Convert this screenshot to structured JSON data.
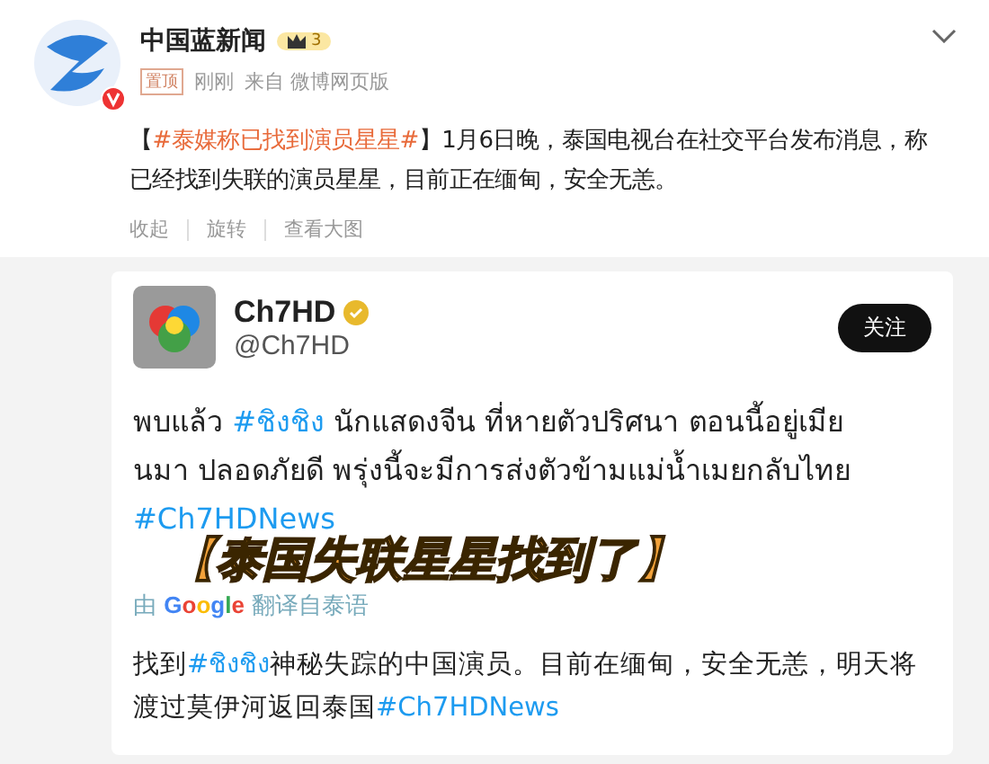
{
  "post": {
    "author": "中国蓝新闻",
    "level_badge": "3",
    "tag": "置顶",
    "time": "刚刚",
    "source": "来自 微博网页版",
    "text_parts": [
      {
        "text": "【",
        "kind": "plain"
      },
      {
        "text": "#泰媒称已找到演员星星#",
        "kind": "tag"
      },
      {
        "text": "】1月6日晚，泰国电视台在社交平台发布消息，称已经找到失联的演员星星，目前正在缅甸，安全无恙。",
        "kind": "plain"
      }
    ],
    "actions": [
      "收起",
      "旋转",
      "查看大图"
    ]
  },
  "embedded": {
    "name": "Ch7HD",
    "handle": "@Ch7HD",
    "follow_button": "关注",
    "thai_parts": [
      {
        "text": "พบแล้ว ",
        "kind": "plain"
      },
      {
        "text": "#ชิงชิง",
        "kind": "tag"
      },
      {
        "text": " นักแสดงจีน ที่หายตัวปริศนา ตอนนี้อยู่เมียนมา ปลอดภัยดี พรุ่งนี้จะมีการส่งตัวข้ามแม่น้ำเมยกลับไทย ",
        "kind": "plain"
      },
      {
        "text": "#Ch7HDNews",
        "kind": "tag"
      }
    ],
    "caption": "【泰国失联星星找到了】",
    "translated_by": "由",
    "google": "Google",
    "translated_from": "翻译自泰语",
    "zh_parts": [
      {
        "text": "找到",
        "kind": "plain"
      },
      {
        "text": "#ชิงชิง",
        "kind": "tag"
      },
      {
        "text": "神秘失踪的中国演员。目前在缅甸，安全无恙，明天将渡过莫伊河返回泰国",
        "kind": "plain"
      },
      {
        "text": "#Ch7HDNews",
        "kind": "tag"
      }
    ]
  }
}
